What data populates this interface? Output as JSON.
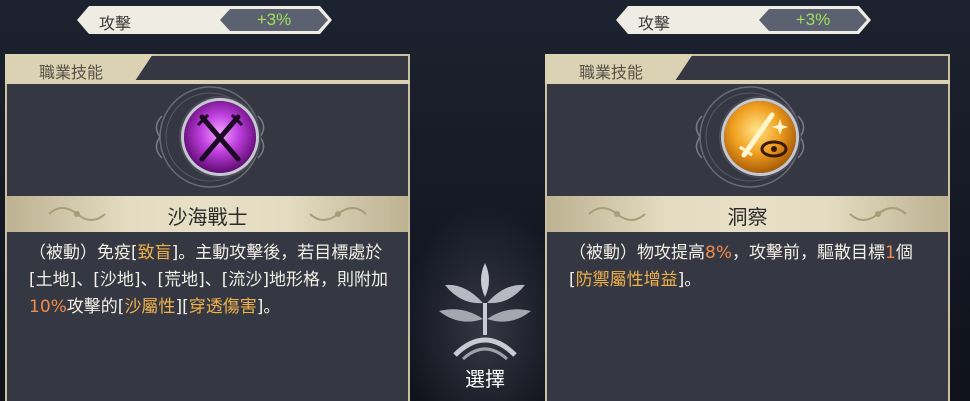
{
  "left_card": {
    "stat": {
      "label": "攻擊",
      "value": "+3%"
    },
    "section_label": "職業技能",
    "skill_name": "沙海戰士",
    "icon": "crossed-swords-purple-icon",
    "desc": {
      "p1": "（被動）免疫[",
      "p2": "致盲",
      "p3": "]。主動攻擊後，若目標處於[土地]、[沙地]、[荒地]、[流沙]地形格，則附加",
      "p4": "10%",
      "p5": "攻擊的[",
      "p6": "沙屬性",
      "p7": "][",
      "p8": "穿透傷害",
      "p9": "]。"
    }
  },
  "right_card": {
    "stat": {
      "label": "攻擊",
      "value": "+3%"
    },
    "section_label": "職業技能",
    "skill_name": "洞察",
    "icon": "sword-eye-gold-icon",
    "desc": {
      "p1": "（被動）物攻提高",
      "p2": "8%",
      "p3": "，攻擊前，驅散目標",
      "p4": "1",
      "p5": "個[",
      "p6": "防禦屬性增益",
      "p7": "]。"
    }
  },
  "select_label": "選擇",
  "colors": {
    "card_bg": "#353742",
    "accent_beige": "#dbd2b3",
    "stat_green": "#9ee05b",
    "highlight_orange": "#f08c4a",
    "highlight_gold": "#f0b24a"
  }
}
